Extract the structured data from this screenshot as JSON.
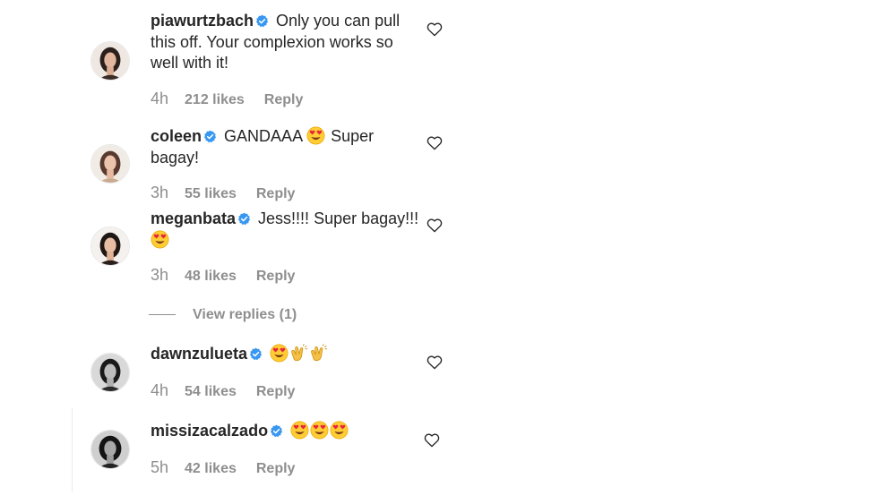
{
  "comments": [
    {
      "username": "piawurtzbach",
      "text_1": "Only you can pull this off. Your complexion works so well with it!",
      "time": "4h",
      "likes": "212 likes",
      "reply": "Reply"
    },
    {
      "username": "coleen",
      "text_1": "GANDAAA",
      "emoji_1": "heart-eyes",
      "text_2": "Super bagay!",
      "time": "3h",
      "likes": "55 likes",
      "reply": "Reply"
    },
    {
      "username": "meganbata",
      "text_1": "Jess!!!! Super bagay!!!",
      "emoji_1": "heart-eyes",
      "time": "3h",
      "likes": "48 likes",
      "reply": "Reply"
    },
    {
      "username": "dawnzulueta",
      "emojis": [
        "heart-eyes",
        "clapping-hands",
        "clapping-hands"
      ],
      "time": "4h",
      "likes": "54 likes",
      "reply": "Reply"
    },
    {
      "username": "missizacalzado",
      "emojis": [
        "heart-eyes",
        "heart-eyes",
        "heart-eyes"
      ],
      "time": "5h",
      "likes": "42 likes",
      "reply": "Reply"
    }
  ],
  "view_replies": "View replies (1)",
  "colors": {
    "verified": "#3897f0",
    "text": "#262626",
    "muted": "#8e8e8e"
  }
}
